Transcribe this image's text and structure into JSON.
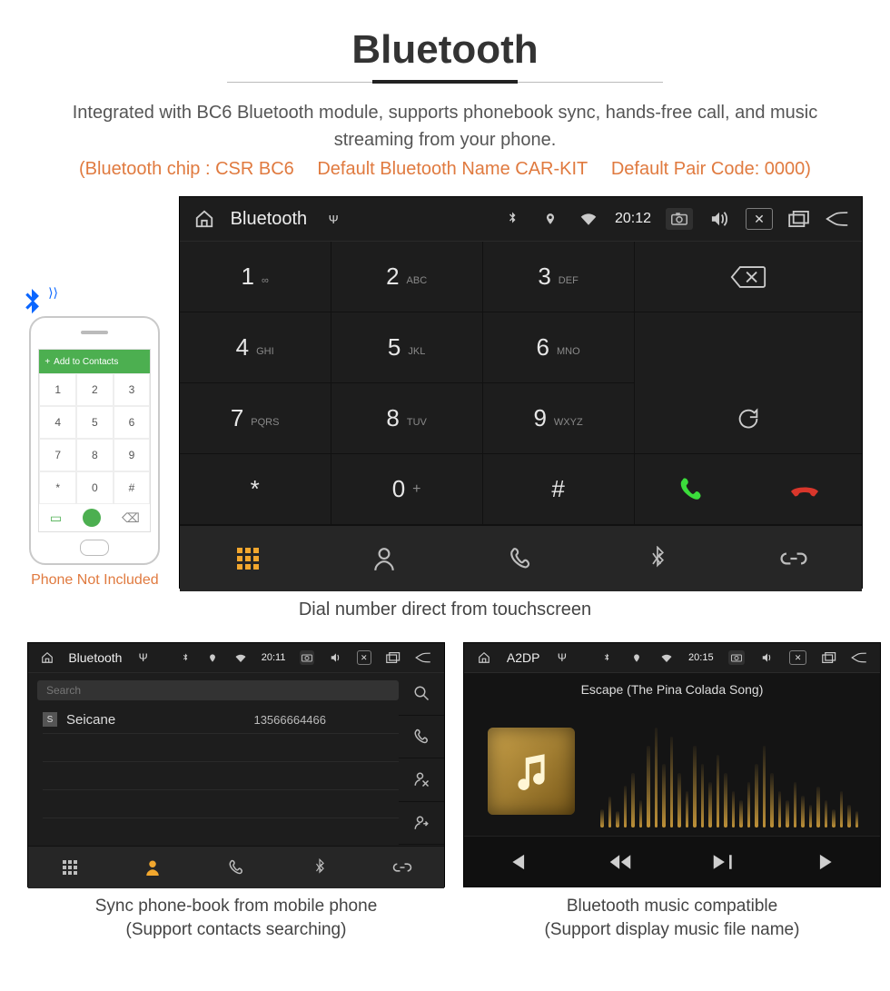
{
  "header": {
    "title": "Bluetooth",
    "subtitle": "Integrated with BC6 Bluetooth module, supports phonebook sync, hands-free call, and music streaming from your phone.",
    "specs": {
      "chip": "(Bluetooth chip : CSR BC6",
      "name": "Default Bluetooth Name CAR-KIT",
      "pair": "Default Pair Code: 0000)"
    }
  },
  "phone": {
    "topbar_label": "Add to Contacts",
    "note": "Phone Not Included",
    "keys": [
      "1",
      "2",
      "3",
      "4",
      "5",
      "6",
      "7",
      "8",
      "9",
      "*",
      "0",
      "#"
    ]
  },
  "main": {
    "status": {
      "title": "Bluetooth",
      "time": "20:12"
    },
    "keys": [
      {
        "n": "1",
        "s": "∞"
      },
      {
        "n": "2",
        "s": "ABC"
      },
      {
        "n": "3",
        "s": "DEF"
      },
      {
        "n": "4",
        "s": "GHI"
      },
      {
        "n": "5",
        "s": "JKL"
      },
      {
        "n": "6",
        "s": "MNO"
      },
      {
        "n": "7",
        "s": "PQRS"
      },
      {
        "n": "8",
        "s": "TUV"
      },
      {
        "n": "9",
        "s": "WXYZ"
      },
      {
        "n": "*",
        "s": ""
      },
      {
        "n": "0",
        "s": "+"
      },
      {
        "n": "#",
        "s": ""
      }
    ],
    "caption": "Dial number direct from touchscreen"
  },
  "phonebook": {
    "status": {
      "title": "Bluetooth",
      "time": "20:11"
    },
    "search_placeholder": "Search",
    "entry": {
      "badge": "S",
      "name": "Seicane",
      "number": "13566664466"
    },
    "caption1": "Sync phone-book from mobile phone",
    "caption2": "(Support contacts searching)"
  },
  "music": {
    "status": {
      "title": "A2DP",
      "time": "20:15"
    },
    "track": "Escape (The Pina Colada Song)",
    "caption1": "Bluetooth music compatible",
    "caption2": "(Support display music file name)"
  }
}
